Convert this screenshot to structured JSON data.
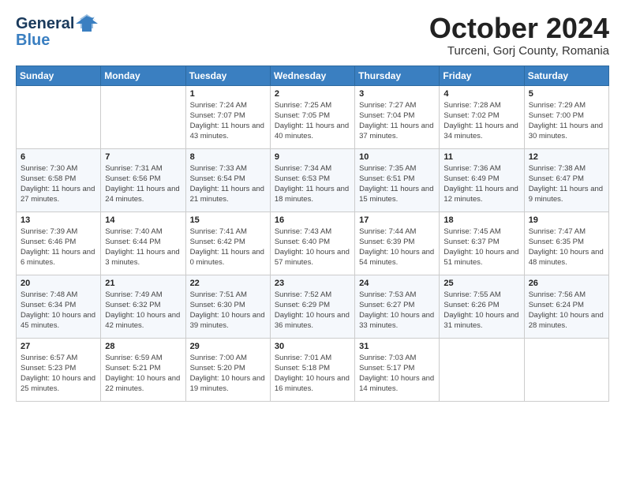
{
  "logo": {
    "line1": "General",
    "line2": "Blue"
  },
  "title": "October 2024",
  "subtitle": "Turceni, Gorj County, Romania",
  "weekdays": [
    "Sunday",
    "Monday",
    "Tuesday",
    "Wednesday",
    "Thursday",
    "Friday",
    "Saturday"
  ],
  "weeks": [
    [
      {
        "day": "",
        "info": ""
      },
      {
        "day": "",
        "info": ""
      },
      {
        "day": "1",
        "info": "Sunrise: 7:24 AM\nSunset: 7:07 PM\nDaylight: 11 hours and 43 minutes."
      },
      {
        "day": "2",
        "info": "Sunrise: 7:25 AM\nSunset: 7:05 PM\nDaylight: 11 hours and 40 minutes."
      },
      {
        "day": "3",
        "info": "Sunrise: 7:27 AM\nSunset: 7:04 PM\nDaylight: 11 hours and 37 minutes."
      },
      {
        "day": "4",
        "info": "Sunrise: 7:28 AM\nSunset: 7:02 PM\nDaylight: 11 hours and 34 minutes."
      },
      {
        "day": "5",
        "info": "Sunrise: 7:29 AM\nSunset: 7:00 PM\nDaylight: 11 hours and 30 minutes."
      }
    ],
    [
      {
        "day": "6",
        "info": "Sunrise: 7:30 AM\nSunset: 6:58 PM\nDaylight: 11 hours and 27 minutes."
      },
      {
        "day": "7",
        "info": "Sunrise: 7:31 AM\nSunset: 6:56 PM\nDaylight: 11 hours and 24 minutes."
      },
      {
        "day": "8",
        "info": "Sunrise: 7:33 AM\nSunset: 6:54 PM\nDaylight: 11 hours and 21 minutes."
      },
      {
        "day": "9",
        "info": "Sunrise: 7:34 AM\nSunset: 6:53 PM\nDaylight: 11 hours and 18 minutes."
      },
      {
        "day": "10",
        "info": "Sunrise: 7:35 AM\nSunset: 6:51 PM\nDaylight: 11 hours and 15 minutes."
      },
      {
        "day": "11",
        "info": "Sunrise: 7:36 AM\nSunset: 6:49 PM\nDaylight: 11 hours and 12 minutes."
      },
      {
        "day": "12",
        "info": "Sunrise: 7:38 AM\nSunset: 6:47 PM\nDaylight: 11 hours and 9 minutes."
      }
    ],
    [
      {
        "day": "13",
        "info": "Sunrise: 7:39 AM\nSunset: 6:46 PM\nDaylight: 11 hours and 6 minutes."
      },
      {
        "day": "14",
        "info": "Sunrise: 7:40 AM\nSunset: 6:44 PM\nDaylight: 11 hours and 3 minutes."
      },
      {
        "day": "15",
        "info": "Sunrise: 7:41 AM\nSunset: 6:42 PM\nDaylight: 11 hours and 0 minutes."
      },
      {
        "day": "16",
        "info": "Sunrise: 7:43 AM\nSunset: 6:40 PM\nDaylight: 10 hours and 57 minutes."
      },
      {
        "day": "17",
        "info": "Sunrise: 7:44 AM\nSunset: 6:39 PM\nDaylight: 10 hours and 54 minutes."
      },
      {
        "day": "18",
        "info": "Sunrise: 7:45 AM\nSunset: 6:37 PM\nDaylight: 10 hours and 51 minutes."
      },
      {
        "day": "19",
        "info": "Sunrise: 7:47 AM\nSunset: 6:35 PM\nDaylight: 10 hours and 48 minutes."
      }
    ],
    [
      {
        "day": "20",
        "info": "Sunrise: 7:48 AM\nSunset: 6:34 PM\nDaylight: 10 hours and 45 minutes."
      },
      {
        "day": "21",
        "info": "Sunrise: 7:49 AM\nSunset: 6:32 PM\nDaylight: 10 hours and 42 minutes."
      },
      {
        "day": "22",
        "info": "Sunrise: 7:51 AM\nSunset: 6:30 PM\nDaylight: 10 hours and 39 minutes."
      },
      {
        "day": "23",
        "info": "Sunrise: 7:52 AM\nSunset: 6:29 PM\nDaylight: 10 hours and 36 minutes."
      },
      {
        "day": "24",
        "info": "Sunrise: 7:53 AM\nSunset: 6:27 PM\nDaylight: 10 hours and 33 minutes."
      },
      {
        "day": "25",
        "info": "Sunrise: 7:55 AM\nSunset: 6:26 PM\nDaylight: 10 hours and 31 minutes."
      },
      {
        "day": "26",
        "info": "Sunrise: 7:56 AM\nSunset: 6:24 PM\nDaylight: 10 hours and 28 minutes."
      }
    ],
    [
      {
        "day": "27",
        "info": "Sunrise: 6:57 AM\nSunset: 5:23 PM\nDaylight: 10 hours and 25 minutes."
      },
      {
        "day": "28",
        "info": "Sunrise: 6:59 AM\nSunset: 5:21 PM\nDaylight: 10 hours and 22 minutes."
      },
      {
        "day": "29",
        "info": "Sunrise: 7:00 AM\nSunset: 5:20 PM\nDaylight: 10 hours and 19 minutes."
      },
      {
        "day": "30",
        "info": "Sunrise: 7:01 AM\nSunset: 5:18 PM\nDaylight: 10 hours and 16 minutes."
      },
      {
        "day": "31",
        "info": "Sunrise: 7:03 AM\nSunset: 5:17 PM\nDaylight: 10 hours and 14 minutes."
      },
      {
        "day": "",
        "info": ""
      },
      {
        "day": "",
        "info": ""
      }
    ]
  ]
}
